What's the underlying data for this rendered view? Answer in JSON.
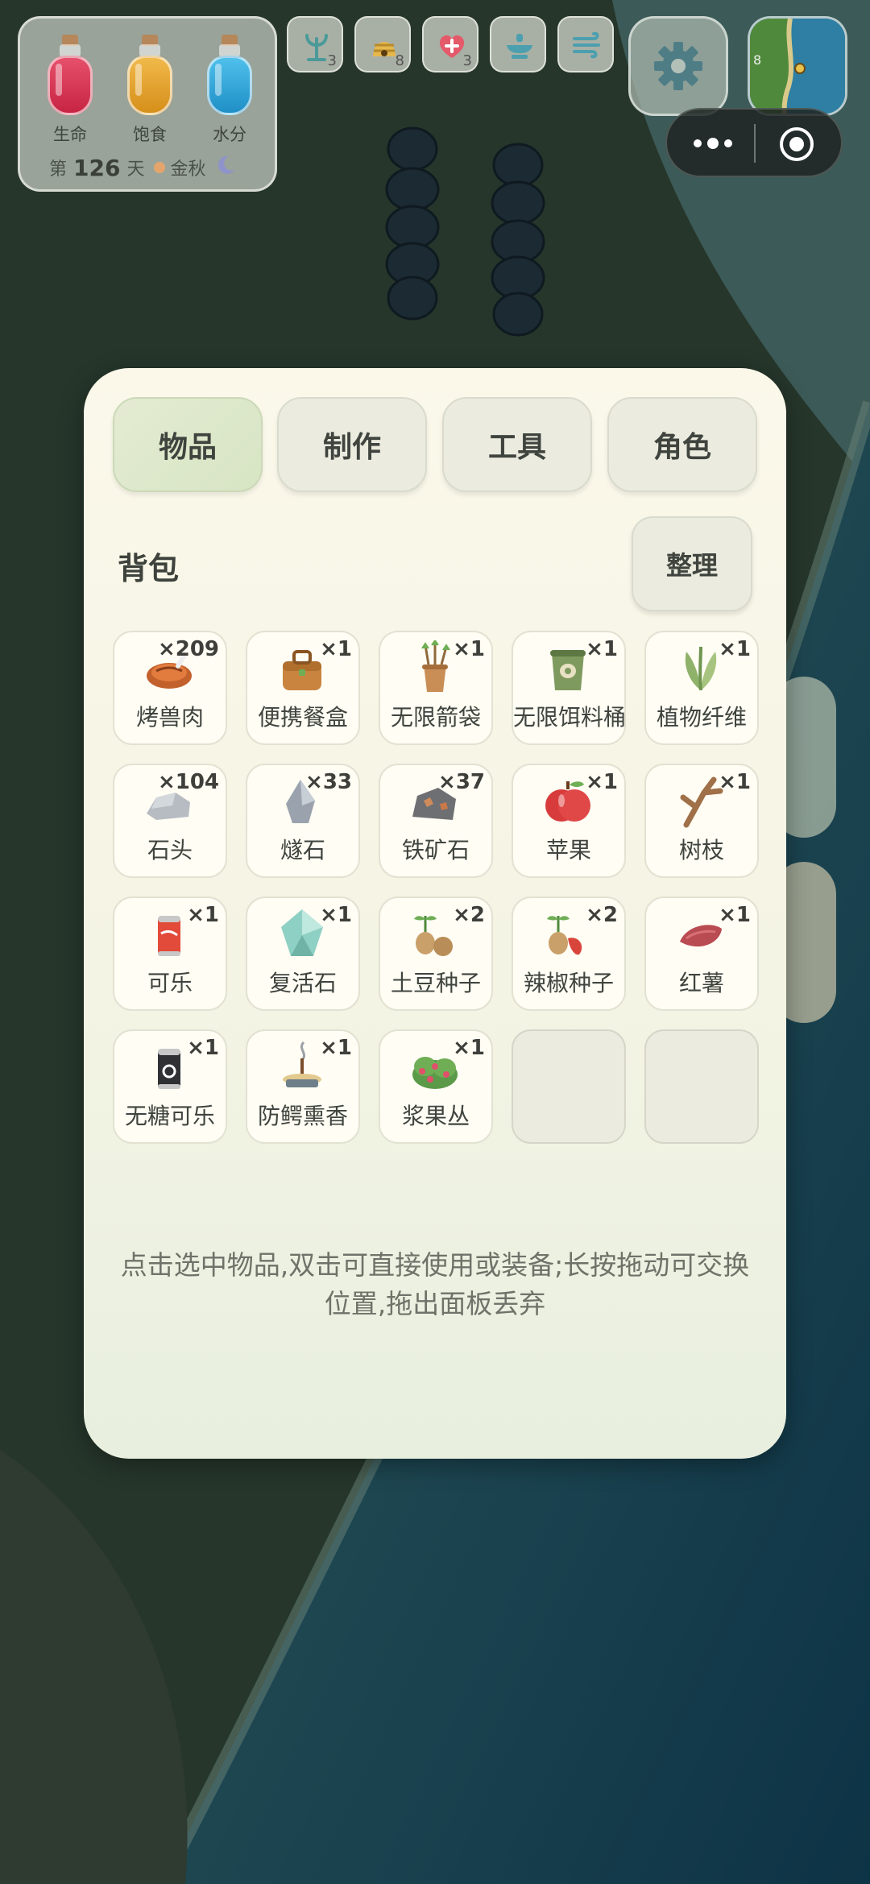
{
  "hud": {
    "stats": [
      {
        "label": "生命",
        "color": "#d6304f"
      },
      {
        "label": "饱食",
        "color": "#e0a12a"
      },
      {
        "label": "水分",
        "color": "#2aa4d6"
      }
    ],
    "day_prefix": "第",
    "day_number": "126",
    "day_suffix": "天",
    "season": "金秋",
    "buffs": [
      {
        "icon": "sprout-icon",
        "count": "3"
      },
      {
        "icon": "beehive-icon",
        "count": "8"
      },
      {
        "icon": "heart-plus-icon",
        "count": "3"
      },
      {
        "icon": "fountain-icon",
        "count": ""
      },
      {
        "icon": "wind-icon",
        "count": ""
      }
    ],
    "minimap_label": "8"
  },
  "panel": {
    "tabs": [
      "物品",
      "制作",
      "工具",
      "角色"
    ],
    "active_tab": 0,
    "section_title": "背包",
    "sort_label": "整理",
    "items": [
      {
        "name": "烤兽肉",
        "qty": "×209",
        "icon": "roast-meat-icon"
      },
      {
        "name": "便携餐盒",
        "qty": "×1",
        "icon": "lunchbox-icon"
      },
      {
        "name": "无限箭袋",
        "qty": "×1",
        "icon": "quiver-icon"
      },
      {
        "name": "无限饵料桶",
        "qty": "×1",
        "icon": "bait-bucket-icon"
      },
      {
        "name": "植物纤维",
        "qty": "×1",
        "icon": "plant-fiber-icon"
      },
      {
        "name": "石头",
        "qty": "×104",
        "icon": "stone-icon"
      },
      {
        "name": "燧石",
        "qty": "×33",
        "icon": "flint-icon"
      },
      {
        "name": "铁矿石",
        "qty": "×37",
        "icon": "iron-ore-icon"
      },
      {
        "name": "苹果",
        "qty": "×1",
        "icon": "apple-icon"
      },
      {
        "name": "树枝",
        "qty": "×1",
        "icon": "branch-icon"
      },
      {
        "name": "可乐",
        "qty": "×1",
        "icon": "cola-icon"
      },
      {
        "name": "复活石",
        "qty": "×1",
        "icon": "revive-stone-icon"
      },
      {
        "name": "土豆种子",
        "qty": "×2",
        "icon": "potato-seed-icon"
      },
      {
        "name": "辣椒种子",
        "qty": "×2",
        "icon": "pepper-seed-icon"
      },
      {
        "name": "红薯",
        "qty": "×1",
        "icon": "sweet-potato-icon"
      },
      {
        "name": "无糖可乐",
        "qty": "×1",
        "icon": "zero-cola-icon"
      },
      {
        "name": "防鳄熏香",
        "qty": "×1",
        "icon": "incense-icon"
      },
      {
        "name": "浆果丛",
        "qty": "×1",
        "icon": "berry-bush-icon"
      },
      {
        "name": "",
        "qty": "",
        "icon": ""
      },
      {
        "name": "",
        "qty": "",
        "icon": ""
      }
    ],
    "hint": "点击选中物品,双击可直接使用或装备;长按拖动可交换位置,拖出面板丢弃"
  }
}
